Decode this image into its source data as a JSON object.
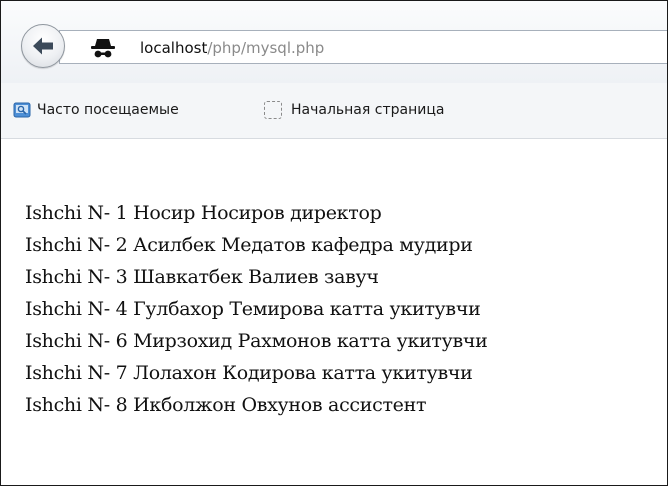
{
  "browser": {
    "url_host": "localhost",
    "url_path": "/php/mysql.php",
    "back_icon": "back-arrow-icon",
    "identity_icon": "private-browsing-mask-icon"
  },
  "bookmarks": {
    "items": [
      {
        "label": "Часто посещаемые",
        "icon": "folder-icon"
      },
      {
        "label": "Начальная страница",
        "icon": "blank-page-icon"
      }
    ]
  },
  "page": {
    "rows": [
      {
        "prefix": "Ishchi N-",
        "number": "1",
        "text": "Носир Носиров директор"
      },
      {
        "prefix": "Ishchi N-",
        "number": "2",
        "text": "Асилбек Медатов кафедра мудири"
      },
      {
        "prefix": "Ishchi N-",
        "number": "3",
        "text": "Шавкатбек Валиев завуч"
      },
      {
        "prefix": "Ishchi N-",
        "number": "4",
        "text": "Гулбахор Темирова катта укитувчи"
      },
      {
        "prefix": "Ishchi N-",
        "number": "6",
        "text": "Мирзохид Рахмонов катта укитувчи"
      },
      {
        "prefix": "Ishchi N-",
        "number": "7",
        "text": "Лолахон Кодирова катта укитувчи"
      },
      {
        "prefix": "Ishchi N-",
        "number": "8",
        "text": "Икболжон Овхунов ассистент"
      }
    ]
  },
  "colors": {
    "url_host": "#111111",
    "url_path": "#8a8a8a",
    "toolbar_bg": "#eef1f5",
    "bookmarks_bg": "#f4f6f8"
  }
}
